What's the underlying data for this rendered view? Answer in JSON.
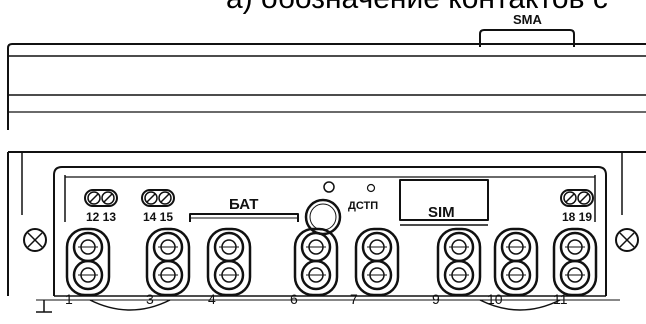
{
  "caption": "а) обозначение контактов с",
  "labels": {
    "sma": "SMA",
    "bat": "БАТ",
    "dstp": "ДСТП",
    "sim": "SIM"
  },
  "small_terminals": [
    {
      "label": "12 13"
    },
    {
      "label": "14 15"
    },
    {
      "label": "18 19"
    }
  ],
  "terminals": [
    {
      "label": "1"
    },
    {
      "label": "3"
    },
    {
      "label": "4"
    },
    {
      "label": "6"
    },
    {
      "label": "7"
    },
    {
      "label": "9"
    },
    {
      "label": "10"
    },
    {
      "label": "11"
    }
  ]
}
